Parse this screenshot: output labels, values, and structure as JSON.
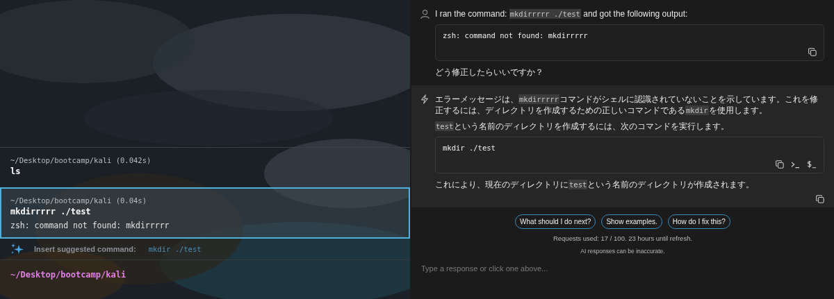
{
  "terminal": {
    "blocks": [
      {
        "path": "~/Desktop/bootcamp/kali",
        "duration": "(0.042s)",
        "command": "ls",
        "selected": false
      },
      {
        "path": "~/Desktop/bootcamp/kali",
        "duration": "(0.04s)",
        "command": "mkdirrrrr ./test",
        "output": "zsh: command not found: mkdirrrrr",
        "selected": true
      }
    ],
    "suggestion": {
      "label": "Insert suggested command:",
      "command": "mkdir ./test"
    },
    "prompt": {
      "path": "~/Desktop/bootcamp/kali"
    }
  },
  "chat": {
    "messages": [
      {
        "kind": "user",
        "copyable": false,
        "parts": [
          {
            "kind": "paragraph",
            "segments": [
              {
                "text": "I ran the command: ",
                "code": false
              },
              {
                "text": "mkdirrrrr ./test",
                "code": true
              },
              {
                "text": " and got the following output:",
                "code": false
              }
            ]
          },
          {
            "kind": "code",
            "text": "zsh: command not found: mkdirrrrr",
            "actions": [
              {
                "kind": "copy"
              }
            ]
          },
          {
            "kind": "paragraph",
            "segments": [
              {
                "text": "どう修正したらいいですか？",
                "code": false
              }
            ]
          }
        ]
      },
      {
        "kind": "assistant",
        "copyable": true,
        "parts": [
          {
            "kind": "paragraph",
            "segments": [
              {
                "text": "エラーメッセージは、",
                "code": false
              },
              {
                "text": "mkdirrrrr",
                "code": true
              },
              {
                "text": "コマンドがシェルに認識されていないことを示しています。これを修正するには、ディレクトリを作成するための正しいコマンドである",
                "code": false
              },
              {
                "text": "mkdir",
                "code": true
              },
              {
                "text": "を使用します。",
                "code": false
              }
            ]
          },
          {
            "kind": "paragraph",
            "segments": [
              {
                "text": "test",
                "code": true
              },
              {
                "text": "という名前のディレクトリを作成するには、次のコマンドを実行します。",
                "code": false
              }
            ]
          },
          {
            "kind": "code",
            "text": "mkdir ./test",
            "actions": [
              {
                "kind": "copy"
              },
              {
                "kind": "terminal"
              },
              {
                "kind": "dollar"
              }
            ]
          },
          {
            "kind": "paragraph",
            "segments": [
              {
                "text": "これにより、現在のディレクトリに",
                "code": false
              },
              {
                "text": "test",
                "code": true
              },
              {
                "text": "という名前のディレクトリが作成されます。",
                "code": false
              }
            ]
          }
        ]
      }
    ],
    "suggestions": [
      "What should I do next?",
      "Show examples.",
      "How do I fix this?"
    ],
    "usage": "Requests used: 17 / 100.  23 hours until refresh.",
    "disclaimer": "AI responses can be inaccurate.",
    "input": {
      "placeholder": "Type a response or click one above..."
    }
  }
}
